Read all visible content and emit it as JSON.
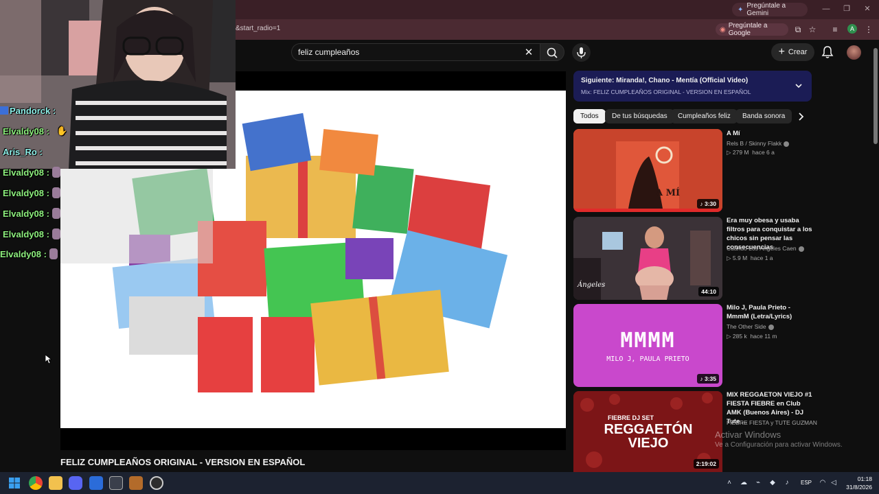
{
  "browser": {
    "gemini_label": "Pregúntale a Gemini",
    "url_fragment": "&start_radio=1",
    "ask_google_label": "Pregúntale a Google",
    "profile_initial": "A"
  },
  "header": {
    "search_value": "feliz cumpleaños",
    "create_label": "Crear"
  },
  "chat": {
    "messages": [
      {
        "user": "Pandorck :"
      },
      {
        "user": "Elvaldy08 :"
      },
      {
        "user": "Aris_Ro :"
      },
      {
        "user": "Elvaldy08 :"
      },
      {
        "user": "Elvaldy08 :"
      },
      {
        "user": "Elvaldy08 :"
      },
      {
        "user": "Elvaldy08 :"
      },
      {
        "user": "Elvaldy08 :"
      }
    ]
  },
  "player": {
    "title": "FELIZ CUMPLEAÑOS ORIGINAL - VERSION EN ESPAÑOL"
  },
  "upnext": {
    "title": "Siguiente: Miranda!, Chano - Mentía (Official Video)",
    "subtitle": "Mix: FELIZ CUMPLEAÑOS ORIGINAL - VERSION EN ESPAÑOL"
  },
  "chips": [
    "Todos",
    "De tus búsquedas",
    "Cumpleaños feliz",
    "Banda sonora"
  ],
  "recommendations": [
    {
      "title": "A Mí",
      "channel": "Rels B / Skinny Flakk",
      "views": "279 M",
      "age": "hace 6 a",
      "duration": "3:30",
      "thumb_text": "A MÍ"
    },
    {
      "title": "Era muy obesa y usaba filtros para conquistar a los chicos sin pensar las consecuencias",
      "channel": "Cuando Los Ángeles Caen",
      "views": "5.9 M",
      "age": "hace 1 a",
      "duration": "44:10",
      "thumb_text": "Ángeles"
    },
    {
      "title": "Milo J, Paula Prieto - MmmM (Letra/Lyrics)",
      "channel": "The Other Side",
      "views": "285 k",
      "age": "hace 11 m",
      "duration": "3:35",
      "thumb_text": "MMMM",
      "thumb_sub": "MILO J, PAULA PRIETO"
    },
    {
      "title": "MIX REGGAETON VIEJO #1 FIESTA FIEBRE en Club AMK (Buenos Aires) - DJ Tute ...",
      "channel": "FIEBRE FIESTA y TUTE GUZMAN",
      "views": "",
      "age": "",
      "duration": "2:19:02",
      "thumb_text": "REGGAETÓN VIEJO",
      "thumb_top": "FIEBRE DJ SET"
    }
  ],
  "windows": {
    "activate_title": "Activar Windows",
    "activate_sub": "Ve a Configuración para activar Windows.",
    "lang": "ESP",
    "time": "01:18",
    "date": "31/8/2026"
  },
  "colors": {
    "browser_frame": "#3a1f26",
    "youtube_bg": "#0f0f0f",
    "upnext_bg": "#1b1c55",
    "chat_green": "#8ef07e",
    "chat_cyan": "#8ff0e9"
  }
}
